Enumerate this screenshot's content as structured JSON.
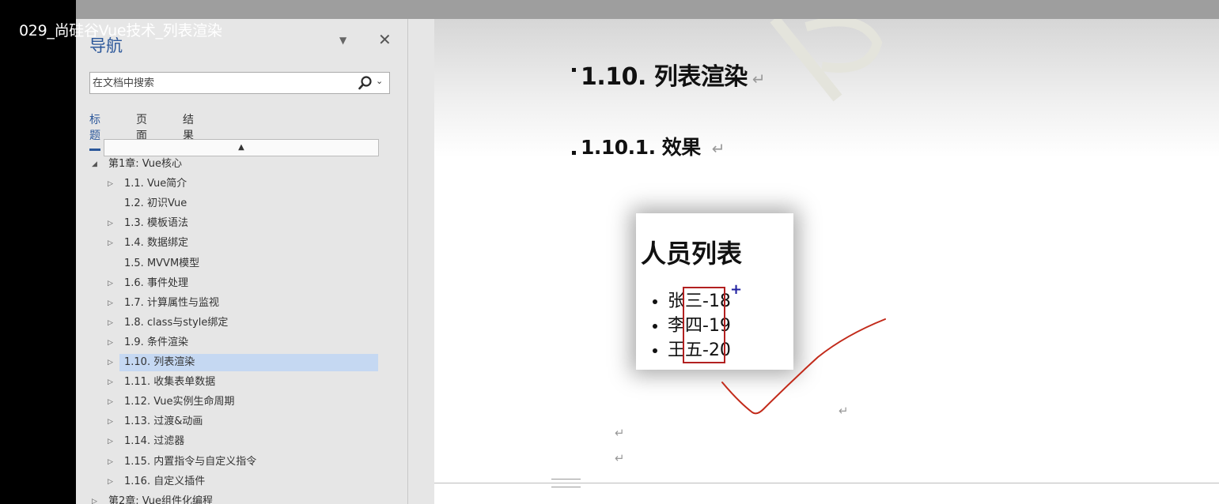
{
  "video_title": "029_尚硅谷Vue技术_列表渲染",
  "nav": {
    "title": "导航",
    "search_placeholder": "在文档中搜索",
    "tabs": [
      "标题",
      "页面",
      "结果"
    ],
    "tree": [
      {
        "label": "第1章: Vue核心",
        "arrow": "◢",
        "level": 0
      },
      {
        "label": "1.1. Vue简介",
        "arrow": "▷",
        "level": 1
      },
      {
        "label": "1.2. 初识Vue",
        "arrow": "",
        "level": 1
      },
      {
        "label": "1.3. 模板语法",
        "arrow": "▷",
        "level": 1
      },
      {
        "label": "1.4. 数据绑定",
        "arrow": "▷",
        "level": 1
      },
      {
        "label": "1.5. MVVM模型",
        "arrow": "",
        "level": 1
      },
      {
        "label": "1.6. 事件处理",
        "arrow": "▷",
        "level": 1
      },
      {
        "label": "1.7. 计算属性与监视",
        "arrow": "▷",
        "level": 1
      },
      {
        "label": "1.8. class与style绑定",
        "arrow": "▷",
        "level": 1
      },
      {
        "label": "1.9. 条件渲染",
        "arrow": "▷",
        "level": 1
      },
      {
        "label": "1.10. 列表渲染",
        "arrow": "▷",
        "level": 1,
        "selected": true
      },
      {
        "label": "1.11. 收集表单数据",
        "arrow": "▷",
        "level": 1
      },
      {
        "label": "1.12. Vue实例生命周期",
        "arrow": "▷",
        "level": 1
      },
      {
        "label": "1.13. 过渡&动画",
        "arrow": "▷",
        "level": 1
      },
      {
        "label": "1.14. 过滤器",
        "arrow": "▷",
        "level": 1
      },
      {
        "label": "1.15. 内置指令与自定义指令",
        "arrow": "▷",
        "level": 1
      },
      {
        "label": "1.16. 自定义插件",
        "arrow": "▷",
        "level": 1
      },
      {
        "label": "第2章: Vue组件化编程",
        "arrow": "▷",
        "level": 0
      }
    ]
  },
  "doc": {
    "heading1": "1.10. 列表渲染",
    "heading2": "1.10.1. 效果",
    "demo": {
      "title": "人员列表",
      "items": [
        "张三-18",
        "李四-19",
        "王五-20"
      ]
    },
    "paragraph_mark": "↵"
  },
  "colors": {
    "accent": "#2b579a",
    "selected_bg": "#c5d8f2",
    "annotation_red": "#b22020"
  }
}
